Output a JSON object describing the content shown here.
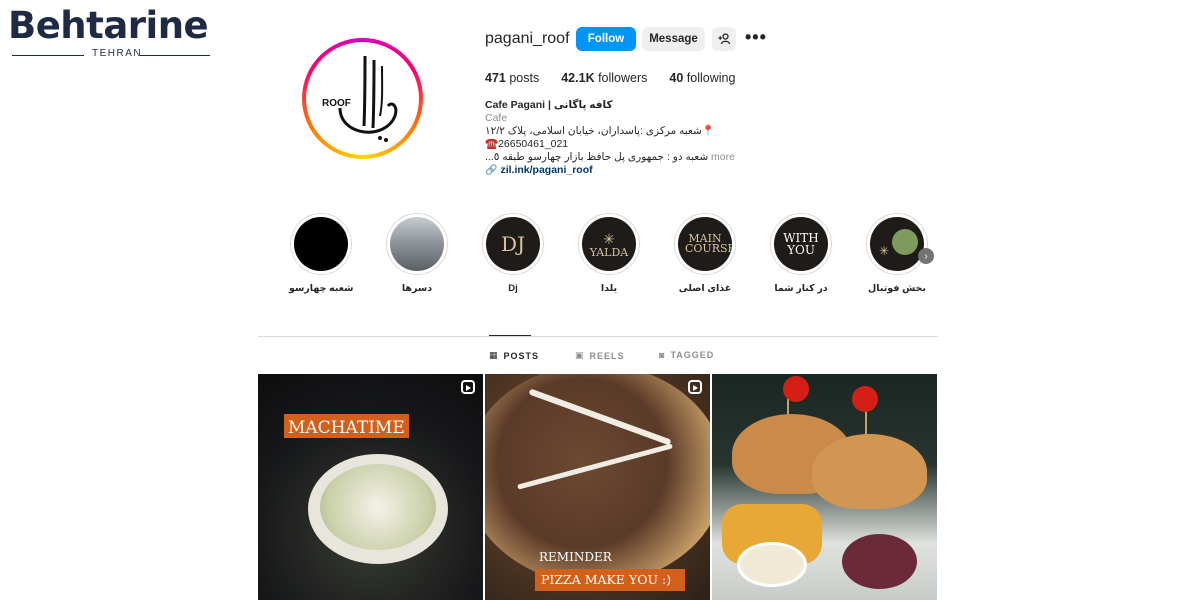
{
  "watermark": {
    "brand": "Behtarine",
    "city": "TEHRAN"
  },
  "profile": {
    "username": "pagani_roof",
    "avatar_text": "ROOF",
    "follow_label": "Follow",
    "message_label": "Message",
    "add_user_icon": "add-user-icon",
    "more_icon": "•••",
    "stats": {
      "posts_value": "471",
      "posts_label": "posts",
      "followers_value": "42.1K",
      "followers_label": "followers",
      "following_value": "40",
      "following_label": "following"
    },
    "bio": {
      "name": "Cafe Pagani | کافه پاگانی",
      "category": "Cafe",
      "line1": "📍شعبه مرکزی :پاسداران، خیابان اسلامی، پلاک ۱۲/۲",
      "line2": "☎️26650461_021",
      "line3": "شعبه دو : جمهوری پل حافظ بازار چهارسو طبقه ٥...",
      "more": "more",
      "link": "zil.ink/pagani_roof"
    }
  },
  "highlights": [
    {
      "label": "شعبه چهارسو",
      "bg": "#000000",
      "text": ""
    },
    {
      "label": "دسرها",
      "bg": "#9aa3a8",
      "text": ""
    },
    {
      "label": "Dj",
      "bg": "#1e1b18",
      "text": "DJ"
    },
    {
      "label": "یلدا",
      "bg": "#1e1b18",
      "text": "YALDA"
    },
    {
      "label": "غذای اصلی",
      "bg": "#1e1b18",
      "text": "MAIN COURSE"
    },
    {
      "label": "در کنار شما",
      "bg": "#1e1b18",
      "text": "WITH YOU"
    },
    {
      "label": "بخش فوتبال",
      "bg": "#1e1b18",
      "text": ""
    }
  ],
  "tabs": [
    {
      "label": "POSTS",
      "icon": "▦"
    },
    {
      "label": "REELS",
      "icon": "▣"
    },
    {
      "label": "TAGGED",
      "icon": "◙"
    }
  ],
  "posts": [
    {
      "overlay": "MACHATIME"
    },
    {
      "overlay1": "REMINDER",
      "overlay2": "PIZZA MAKE YOU :)"
    },
    {
      "overlay": ""
    }
  ],
  "colors": {
    "accent": "#0095f6",
    "link": "#00376b",
    "orange": "#d2601a"
  }
}
